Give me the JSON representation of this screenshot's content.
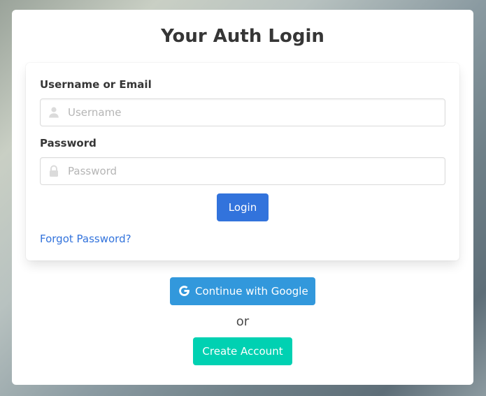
{
  "page": {
    "title": "Your Auth Login"
  },
  "form": {
    "username_label": "Username or Email",
    "username_placeholder": "Username",
    "username_value": "",
    "username_icon": "user-icon",
    "password_label": "Password",
    "password_placeholder": "Password",
    "password_value": "",
    "password_icon": "lock-icon",
    "login_button": "Login",
    "forgot_link": "Forgot Password?"
  },
  "alt_actions": {
    "google_button": "Continue with Google",
    "google_icon": "google-icon",
    "separator": "or",
    "create_account_button": "Create Account"
  },
  "colors": {
    "primary": "#3273dc",
    "info": "#3298dc",
    "success": "#00d1b2",
    "text": "#363636",
    "border": "#dbdbdb"
  }
}
